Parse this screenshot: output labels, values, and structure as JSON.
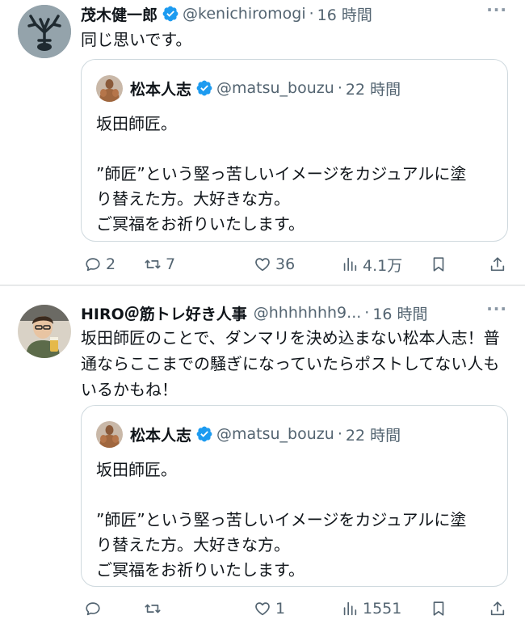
{
  "tweets": [
    {
      "author": {
        "name": "茂木健一郎",
        "handle": "@kenichiromogi",
        "verified": true,
        "avatar_icon": "antler-avatar-icon"
      },
      "time": "16 時間",
      "separator": "·",
      "text": "同じ思いです。",
      "quote": {
        "author": {
          "name": "松本人志",
          "handle": "@matsu_bouzu",
          "verified": true
        },
        "time": "22 時間",
        "separator": "·",
        "lines": [
          "坂田師匠。",
          "",
          "”師匠”という堅っ苦しいイメージをカジュアルに塗",
          "り替えた方。大好きな方。",
          "ご冥福をお祈りいたします。"
        ]
      },
      "actions": {
        "replies": "2",
        "retweets": "7",
        "likes": "36",
        "views": "4.1万"
      },
      "more_label": "···"
    },
    {
      "author": {
        "name": "HIRO＠筋トレ好き人事",
        "handle": "@hhhhhhh9...",
        "verified": false,
        "avatar_icon": "person-avatar-icon"
      },
      "time": "16 時間",
      "separator": "·",
      "text": "坂田師匠のことで、ダンマリを決め込まない松本人志！普通ならここまでの騒ぎになっていたらポストしてない人もいるかもね！",
      "quote": {
        "author": {
          "name": "松本人志",
          "handle": "@matsu_bouzu",
          "verified": true
        },
        "time": "22 時間",
        "separator": "·",
        "lines": [
          "坂田師匠。",
          "",
          "”師匠”という堅っ苦しいイメージをカジュアルに塗",
          "り替えた方。大好きな方。",
          "ご冥福をお祈りいたします。"
        ]
      },
      "actions": {
        "replies": "",
        "retweets": "",
        "likes": "1",
        "views": "1551"
      },
      "more_label": "···"
    }
  ],
  "colors": {
    "verified": "#1d9bf0",
    "secondary_text": "#536471",
    "border": "#cfd9de",
    "text": "#0f1419"
  }
}
